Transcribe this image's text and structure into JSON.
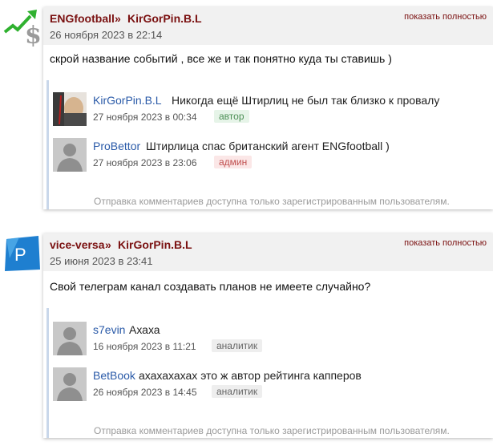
{
  "threads": [
    {
      "avatar_icon": "money-growth-icon",
      "user": "ENGfootball",
      "separator": "»",
      "reply_to": "KirGorPin.B.L",
      "date": "26 ноября 2023 в 22:14",
      "show_full": "показать полностью",
      "text": "скрой название событий , все же и так понятно куда ты ставишь )",
      "replies": [
        {
          "avatar_icon": "photo-avatar-icon",
          "name": "KirGorPin.B.L",
          "text": "Никогда ещё Штирлиц не был так близко к провалу",
          "date": "27 ноября 2023 в 00:34",
          "badge": "автор",
          "badge_type": "author"
        },
        {
          "avatar_icon": "default-avatar-icon",
          "name": "ProBettor",
          "text": "Штирлица спас британский агент ENGfootball )",
          "date": "27 ноября 2023 в 23:06",
          "badge": "админ",
          "badge_type": "admin"
        }
      ],
      "notice": "Отправка комментариев доступна только зарегистрированным пользователям."
    },
    {
      "avatar_icon": "letter-p-avatar-icon",
      "avatar_letter": "P",
      "user": "vice-versa",
      "separator": "»",
      "reply_to": "KirGorPin.B.L",
      "date": "25 июня 2023 в 23:41",
      "show_full": "показать полностью",
      "text": "Свой телеграм канал создавать планов не имеете случайно?",
      "replies": [
        {
          "avatar_icon": "default-avatar-icon",
          "name": "s7evin",
          "text": "Ахаха",
          "date": "16 ноября 2023 в 11:21",
          "badge": "аналитик",
          "badge_type": "analyst"
        },
        {
          "avatar_icon": "default-avatar-icon",
          "name": "BetBook",
          "text": "ахахахахах это ж автор рейтинга капперов",
          "date": "26 ноября 2023 в 14:45",
          "badge": "аналитик",
          "badge_type": "analyst"
        }
      ],
      "notice": "Отправка комментариев доступна только зарегистрированным пользователям."
    }
  ]
}
